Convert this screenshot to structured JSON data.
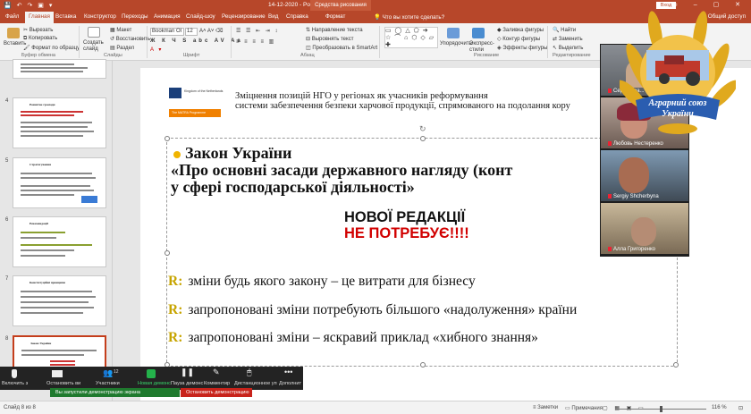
{
  "app": {
    "title": "14-12-2020 - PowerPoint",
    "contextual_group": "Средства рисования",
    "sign_in": "Вход"
  },
  "tabs": [
    {
      "label": "Файл"
    },
    {
      "label": "Главная",
      "active": true
    },
    {
      "label": "Вставка"
    },
    {
      "label": "Конструктор"
    },
    {
      "label": "Переходы"
    },
    {
      "label": "Анимация"
    },
    {
      "label": "Слайд-шоу"
    },
    {
      "label": "Рецензирование"
    },
    {
      "label": "Вид"
    },
    {
      "label": "Справка"
    },
    {
      "label": "Формат"
    }
  ],
  "tell_me": "Что вы хотите сделать?",
  "share": "Общий доступ",
  "ribbon": {
    "clipboard": {
      "paste": "Вставить",
      "cut": "Вырезать",
      "copy": "Копировать",
      "format_painter": "Формат по образцу",
      "group": "Буфер обмена"
    },
    "slides": {
      "new_slide": "Создать слайд",
      "layout": "Макет",
      "reset": "Восстановить",
      "section": "Раздел",
      "group": "Слайды"
    },
    "font": {
      "family": "Bookman Ol",
      "size": "12",
      "group": "Шрифт"
    },
    "paragraph": {
      "text_direction": "Направление текста",
      "align_text": "Выровнять текст",
      "smartart": "Преобразовать в SmartArt",
      "group": "Абзац"
    },
    "drawing": {
      "arrange": "Упорядочить",
      "quick_styles": "Экспресс-стили",
      "shape_fill": "Заливка фигуры",
      "shape_outline": "Контур фигуры",
      "shape_effects": "Эффекты фигуры",
      "group": "Рисование"
    },
    "editing": {
      "find": "Найти",
      "replace": "Заменить",
      "select": "Выделить",
      "group": "Редактирование"
    }
  },
  "thumbnails": [
    {
      "number": "4",
      "title": "Розвиток громади"
    },
    {
      "number": "5",
      "title": "Стратегування"
    },
    {
      "number": "6",
      "title": "Рекомендації"
    },
    {
      "number": "7",
      "title": "Конституційні принципи"
    },
    {
      "number": "8",
      "title": "Закон України",
      "selected": true
    }
  ],
  "slide": {
    "logo_text": "Kingdom of the Netherlands",
    "logo_bar": "The MATRA Programme",
    "header_line1": "Зміцнення позицій НГО у регіонах як учасників реформування",
    "header_line2": "системи забезпечення безпеки харчової продукції, спрямованого на подолання кору",
    "law_line1": "Закон України",
    "law_line2": "«Про основні засади державного нагляду (конт",
    "law_line3": "у сфері господарської діяльності»",
    "red_line1": "НОВОЇ РЕДАКЦІЇ",
    "red_line2": "НЕ ПОТРЕБУЄ!!!!",
    "r_marker": "R:",
    "points": [
      "зміни будь якого закону – це витрати для бізнесу",
      "запропоновані зміни потребують більшого «надолуження» країни",
      "запропоновані зміни – яскравий приклад «хибного знання»"
    ]
  },
  "videos": [
    {
      "name": "Сергій Тра..."
    },
    {
      "name": "Любовь Нестеренко"
    },
    {
      "name": "Sergiy Shcherbyna"
    },
    {
      "name": "Алла Григоренко"
    }
  ],
  "emblem": {
    "line1": "Аграрний союз",
    "line2": "України"
  },
  "zoom_controls": [
    {
      "label": "Включить з"
    },
    {
      "label": "Остановить ви"
    },
    {
      "label": "Участники",
      "count": "12"
    },
    {
      "label": "Новая демонс"
    },
    {
      "label": "Пауза демонс"
    },
    {
      "label": "Комментир"
    },
    {
      "label": "Дистанционное уп"
    },
    {
      "label": "Дополнит"
    }
  ],
  "sharing_banner": "Вы запустили демонстрацию экрана",
  "stop_sharing": "Остановить демонстрацию",
  "status": {
    "slide_info": "Слайд 8 из 8",
    "notes": "Заметки",
    "comments": "Примечания",
    "zoom": "116 %"
  },
  "colors": {
    "accent": "#b7472a",
    "title_red": "#d10000",
    "marker_gold": "#c7a400",
    "bullet_yellow": "#f0b400"
  }
}
